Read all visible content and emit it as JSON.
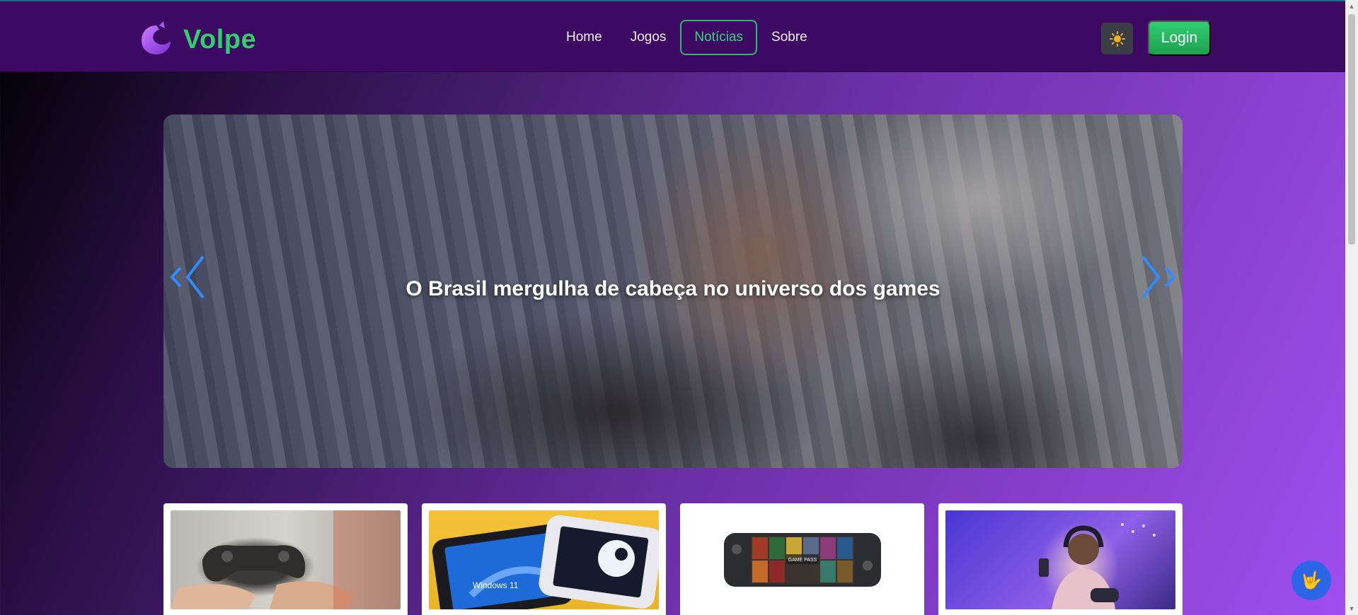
{
  "brand": {
    "name": "Volpe",
    "logo_icon": "fox-logo-icon",
    "accent": "#2fcf6b"
  },
  "nav": {
    "items": [
      {
        "label": "Home",
        "active": false
      },
      {
        "label": "Jogos",
        "active": false
      },
      {
        "label": "Notícias",
        "active": true
      },
      {
        "label": "Sobre",
        "active": false
      }
    ]
  },
  "header": {
    "theme_icon": "sun-icon",
    "login_label": "Login"
  },
  "carousel": {
    "slide_title": "O Brasil mergulha de cabeça no universo dos games",
    "prev_icon": "chevron-left-icon",
    "next_icon": "chevron-right-icon"
  },
  "cards": [
    {
      "image": "controller-hands-photo"
    },
    {
      "image": "handheld-consoles-photo",
      "labels": [
        "Windows 11"
      ]
    },
    {
      "image": "game-pass-controller-photo",
      "labels": [
        "GAME PASS"
      ]
    },
    {
      "image": "gamer-girl-photo"
    }
  ],
  "fab": {
    "icon": "accessibility-hand-icon"
  }
}
